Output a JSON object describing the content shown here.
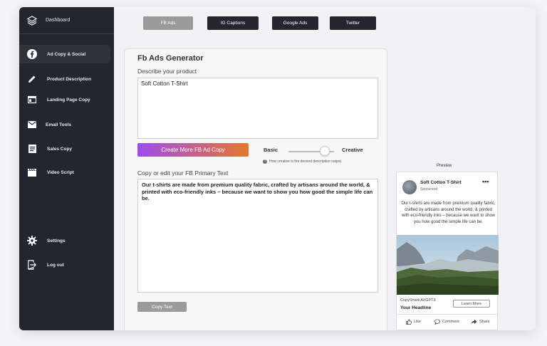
{
  "sidebar": {
    "header": "Dashboard",
    "items": [
      {
        "label": "Ad Copy & Social",
        "icon": "facebook-icon",
        "active": true
      },
      {
        "label": "Product Description",
        "icon": "pencil-icon"
      },
      {
        "label": "Landing Page Copy",
        "icon": "landing-page-icon"
      },
      {
        "label": "Email Tools",
        "icon": "mail-icon"
      },
      {
        "label": "Sales Copy",
        "icon": "document-icon"
      },
      {
        "label": "Video Script",
        "icon": "clapperboard-icon"
      }
    ],
    "settings": "Settings",
    "logout": "Log out"
  },
  "tabs": [
    {
      "label": "FB Ads",
      "active": true
    },
    {
      "label": "IG Captions"
    },
    {
      "label": "Google Ads"
    },
    {
      "label": "Twitter"
    }
  ],
  "form": {
    "title": "Fb Ads Generator",
    "describe_label": "Describe your product",
    "describe_value": "Soft Cotton T-Shirt",
    "generate_button": "Create More FB Ad Copy",
    "slider_left": "Basic",
    "slider_right": "Creative",
    "slider_value": 0.8,
    "slider_help": "How creative is the desired description output.",
    "edit_label": "Copy or edit your FB Primary Text",
    "primary_text": "Our t-shirts are made from premium quality fabric, crafted by artisans around the world, & printed with eco-friendly inks – because we want to show you how good the simple life can be.",
    "copy_button": "Copy Text"
  },
  "preview": {
    "label": "Preview",
    "page_name": "Soft Cotton T-Shirt",
    "sponsored": "Sponsored",
    "text": "Our t-shirts are made from premium quality fabric, crafted by artisans around the world, & printed with eco-friendly inks – because we want to show you how good the simple life can be.",
    "brand": "CopyShark AI/GPT3",
    "headline": "Your Headline",
    "cta": "Learn More",
    "actions": [
      "Like",
      "Comment",
      "Share"
    ]
  },
  "colors": {
    "sidebar_bg": "#23262e",
    "gradient_start": "#9b4df0",
    "gradient_end": "#e8762c"
  }
}
